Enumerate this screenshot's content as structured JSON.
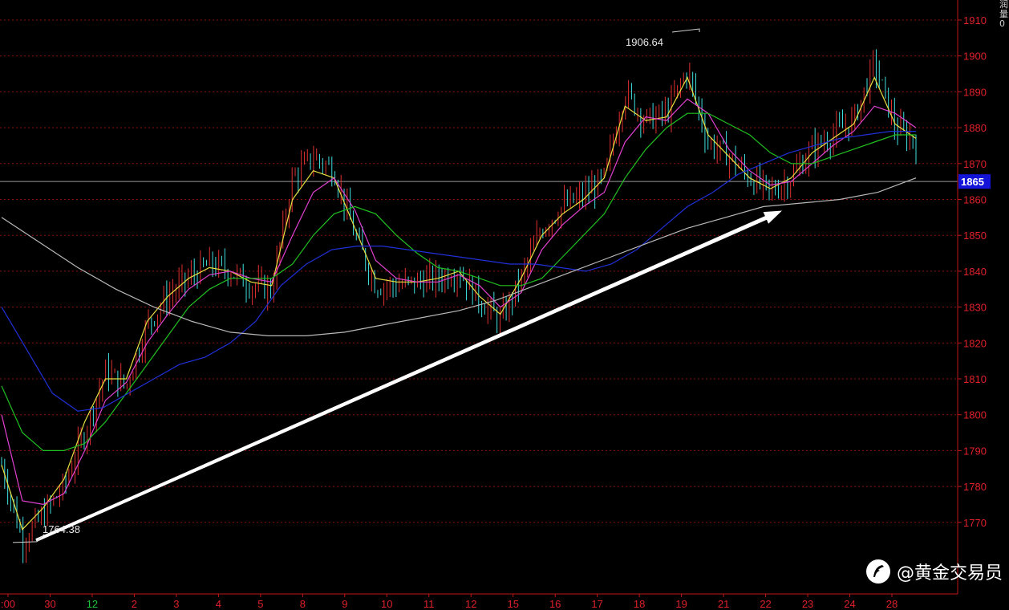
{
  "chart_data": {
    "type": "line",
    "title": "",
    "xlabel": "",
    "ylabel": "",
    "ylim": [
      1760,
      1915
    ],
    "y_ticks": [
      1910,
      1900,
      1890,
      1880,
      1870,
      1860,
      1850,
      1840,
      1830,
      1820,
      1810,
      1800,
      1790,
      1780,
      1770
    ],
    "x_ticks": [
      {
        "label": ":00",
        "green": false
      },
      {
        "label": "30",
        "green": false
      },
      {
        "label": "12",
        "green": true
      },
      {
        "label": "2",
        "green": false
      },
      {
        "label": "3",
        "green": false
      },
      {
        "label": "4",
        "green": false
      },
      {
        "label": "5",
        "green": false
      },
      {
        "label": "8",
        "green": false
      },
      {
        "label": "9",
        "green": false
      },
      {
        "label": "10",
        "green": false
      },
      {
        "label": "11",
        "green": false
      },
      {
        "label": "12",
        "green": false
      },
      {
        "label": "15",
        "green": false
      },
      {
        "label": "16",
        "green": false
      },
      {
        "label": "17",
        "green": false
      },
      {
        "label": "18",
        "green": false
      },
      {
        "label": "19",
        "green": false
      },
      {
        "label": "21",
        "green": false
      },
      {
        "label": "22",
        "green": false
      },
      {
        "label": "23",
        "green": false
      },
      {
        "label": "24",
        "green": false
      },
      {
        "label": "28",
        "green": false
      }
    ],
    "grid": true,
    "current_price": "1865",
    "high_label": "1906.64",
    "low_label": "1764.38",
    "price_path": [
      1786,
      1765,
      1772,
      1780,
      1795,
      1812,
      1808,
      1825,
      1833,
      1838,
      1842,
      1840,
      1836,
      1835,
      1866,
      1872,
      1868,
      1850,
      1836,
      1836,
      1837,
      1838,
      1840,
      1832,
      1826,
      1838,
      1852,
      1858,
      1861,
      1866,
      1890,
      1882,
      1884,
      1896,
      1876,
      1872,
      1866,
      1862,
      1866,
      1874,
      1878,
      1882,
      1898,
      1880,
      1876
    ],
    "series": [
      {
        "name": "",
        "color": "#e8e040",
        "values": [
          1786,
          1768,
          1774,
          1782,
          1798,
          1810,
          1810,
          1826,
          1833,
          1838,
          1841,
          1840,
          1837,
          1836,
          1860,
          1868,
          1866,
          1852,
          1838,
          1837,
          1837,
          1838,
          1840,
          1833,
          1828,
          1838,
          1850,
          1856,
          1860,
          1866,
          1886,
          1882,
          1883,
          1894,
          1878,
          1872,
          1866,
          1863,
          1866,
          1873,
          1877,
          1881,
          1894,
          1881,
          1877
        ]
      },
      {
        "name": "",
        "color": "#e040d0",
        "values": [
          1800,
          1776,
          1775,
          1778,
          1790,
          1804,
          1809,
          1820,
          1828,
          1835,
          1839,
          1840,
          1838,
          1837,
          1850,
          1862,
          1866,
          1857,
          1843,
          1838,
          1837,
          1837,
          1839,
          1836,
          1830,
          1834,
          1846,
          1853,
          1858,
          1862,
          1876,
          1883,
          1882,
          1888,
          1884,
          1874,
          1868,
          1864,
          1865,
          1870,
          1875,
          1879,
          1886,
          1884,
          1880
        ]
      },
      {
        "name": "",
        "color": "#20c020",
        "values": [
          1808,
          1795,
          1790,
          1790,
          1792,
          1798,
          1806,
          1814,
          1822,
          1830,
          1835,
          1838,
          1838,
          1838,
          1842,
          1850,
          1856,
          1858,
          1856,
          1850,
          1845,
          1841,
          1840,
          1838,
          1836,
          1836,
          1838,
          1844,
          1850,
          1856,
          1866,
          1874,
          1880,
          1884,
          1884,
          1881,
          1878,
          1873,
          1870,
          1870,
          1872,
          1874,
          1876,
          1878,
          1878
        ]
      },
      {
        "name": "",
        "color": "#2030d8",
        "values": [
          1830,
          1818,
          1806,
          1801,
          1802,
          1806,
          1810,
          1814,
          1816,
          1820,
          1826,
          1836,
          1842,
          1846,
          1847,
          1847,
          1846,
          1845,
          1844,
          1843,
          1842,
          1842,
          1841,
          1840,
          1842,
          1846,
          1852,
          1858,
          1862,
          1867,
          1870,
          1873,
          1875,
          1877,
          1878,
          1879,
          1879
        ]
      },
      {
        "name": "",
        "color": "#b8b8b8",
        "values": [
          1855,
          1848,
          1841,
          1835,
          1830,
          1826,
          1823,
          1822,
          1822,
          1823,
          1825,
          1827,
          1829,
          1832,
          1836,
          1840,
          1844,
          1848,
          1852,
          1855,
          1858,
          1859,
          1860,
          1862,
          1866
        ]
      }
    ],
    "arrow": {
      "from": [
        1,
        1765
      ],
      "to": [
        24,
        1860
      ]
    }
  },
  "watermark": {
    "text": "@黄金交易员",
    "icon": "feather-logo-icon"
  },
  "sidebar_glyphs": [
    "润",
    "量",
    "0"
  ]
}
